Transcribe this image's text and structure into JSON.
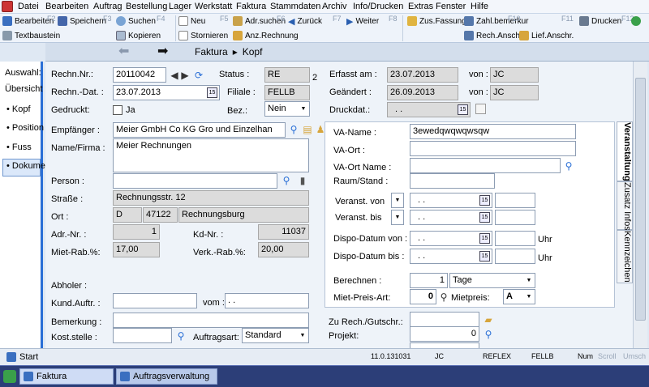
{
  "menu": [
    "Datei",
    "Bearbeiten",
    "Auftrag",
    "Bestellung",
    "Lager",
    "Werkstatt",
    "Faktura",
    "Stammdaten",
    "Archiv",
    "Info/Drucken",
    "Extras",
    "Fenster",
    "Hilfe"
  ],
  "toolbar": {
    "bearbeiten": "Bearbeiten",
    "speichern": "Speichern",
    "suchen": "Suchen",
    "neu": "Neu",
    "adr_suchen": "Adr.suchen",
    "zurueck": "Zurück",
    "weiter": "Weiter",
    "zus_fassung": "Zus.Fassung",
    "zahl_bemerkung": "Zahl.bemerkur",
    "drucken": "Drucken",
    "textbaustein": "Textbaustein",
    "kopieren": "Kopieren",
    "stornieren": "Stornieren",
    "anz_rechnung": "Anz.Rechnung",
    "rech_anschr": "Rech.Anschr.",
    "lief_anschr": "Lief.Anschr.",
    "fkeys": [
      "F2",
      "F3",
      "F4",
      "F5",
      "F6",
      "F7",
      "F8",
      "F9",
      "F10",
      "F11",
      "F12"
    ]
  },
  "nav": {
    "title": "Faktura",
    "sep": "▸",
    "section": "Kopf"
  },
  "sidebar": {
    "items": [
      "Auswahl:",
      "Übersicht",
      "• Kopf",
      "• Position",
      "• Fuss",
      "• Dokume"
    ]
  },
  "form": {
    "rechn_nr_label": "Rechn.Nr.:",
    "rechn_nr": "20110042",
    "status_label": "Status :",
    "status": "RE",
    "status_num": "2",
    "erfasst_label": "Erfasst am :",
    "erfasst": "23.07.2013",
    "von1_label": "von :",
    "von1": "JC",
    "rechn_dat_label": "Rechn.-Dat. :",
    "rechn_dat": "23.07.2013",
    "filiale_label": "Filiale :",
    "filiale": "FELLB",
    "geaendert_label": "Geändert :",
    "geaendert": "26.09.2013",
    "von2_label": "von :",
    "von2": "JC",
    "gedruckt_label": "Gedruckt:",
    "gedruckt_val": "Ja",
    "bez_label": "Bez.:",
    "bez": "Nein",
    "druckdat_label": "Druckdat.:",
    "druckdat": ". .",
    "empfaenger_label": "Empfänger :",
    "empfaenger": "Meier GmbH  Co KG Gro und Einzelhan",
    "name_label": "Name/Firma :",
    "name": "Meier Rechnungen",
    "person_label": "Person :",
    "person": "",
    "strasse_label": "Straße :",
    "strasse": "Rechnungsstr. 12",
    "ort_label": "Ort :",
    "ort_land": "D",
    "ort_plz": "47122",
    "ort": "Rechnungsburg",
    "adr_nr_label": "Adr.-Nr. :",
    "adr_nr": "1",
    "kd_nr_label": "Kd-Nr. :",
    "kd_nr": "11037",
    "miet_rab_label": "Miet-Rab.%:",
    "miet_rab": "17,00",
    "verk_rab_label": "Verk.-Rab.%:",
    "verk_rab": "20,00",
    "abholer_label": "Abholer :",
    "kund_auftr_label": "Kund.Auftr. :",
    "kund_auftr": "",
    "vom_label": "vom :",
    "vom": ". .",
    "bemerkung_label": "Bemerkung :",
    "bemerkung": "",
    "koststelle_label": "Kost.stelle :",
    "koststelle": "",
    "auftragsart_label": "Auftragsart:",
    "auftragsart": "Standard",
    "zu_rech_label": "Zu Rech./Gutschr.:",
    "zu_rech": "",
    "projekt_label": "Projekt:",
    "projekt": "0"
  },
  "va": {
    "va_name_label": "VA-Name :",
    "va_name": "3ewedqwqwqwsqw",
    "va_ort_label": "VA-Ort :",
    "va_ort": "",
    "va_ort_name_label": "VA-Ort Name :",
    "va_ort_name": "",
    "raum_label": "Raum/Stand :",
    "raum": "",
    "veranst_von_label": "Veranst. von",
    "veranst_von": ". .",
    "veranst_bis_label": "Veranst. bis",
    "veranst_bis": ". .",
    "dispo_von_label": "Dispo-Datum von :",
    "dispo_von": ". .",
    "uhr1": "Uhr",
    "dispo_bis_label": "Dispo-Datum bis :",
    "dispo_bis": ". .",
    "uhr2": "Uhr",
    "berechnen_label": "Berechnen :",
    "berechnen_num": "1",
    "berechnen_unit": "Tage",
    "miet_preis_art_label": "Miet-Preis-Art:",
    "miet_preis_art": "0",
    "mietpreis_label": "Mietpreis:",
    "mietpreis": "A"
  },
  "tabs": [
    "Veranstaltung",
    "Zusatz Infos",
    "Kennzeichen"
  ],
  "status": {
    "start": "Start",
    "version": "11.0.131031",
    "user": "JC",
    "db": "REFLEX",
    "filiale": "FELLB",
    "num": "Num",
    "scroll": "Scroll",
    "umsch": "Umsch"
  },
  "taskbar": [
    "Faktura",
    "Auftragsverwaltung"
  ],
  "colors": {
    "accent": "#2a6fd6",
    "taskbar": "#2c3e78",
    "readonly": "#dcdcdc"
  }
}
